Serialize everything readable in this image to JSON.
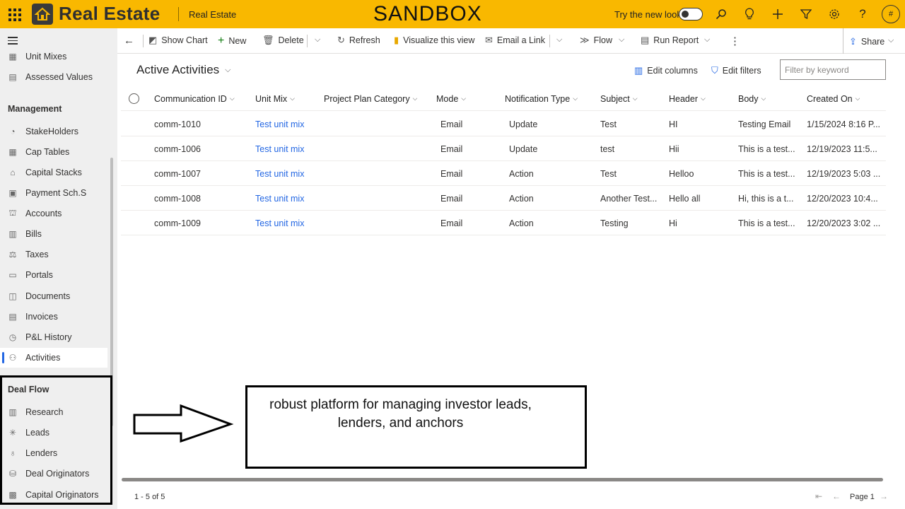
{
  "topbar": {
    "brand": "Real Estate",
    "app_name": "Real Estate",
    "environment": "SANDBOX",
    "try_new_look": "Try the new look",
    "avatar": "#",
    "accent_color": "#f9b800"
  },
  "sidebar": {
    "top_items": [
      {
        "label": "Unit Mixes",
        "icon": "table-icon"
      },
      {
        "label": "Assessed Values",
        "icon": "value-icon"
      }
    ],
    "management_heading": "Management",
    "management_items": [
      {
        "label": "StakeHolders",
        "icon": "stakeholder-icon"
      },
      {
        "label": "Cap Tables",
        "icon": "grid-icon"
      },
      {
        "label": "Capital Stacks",
        "icon": "stack-icon"
      },
      {
        "label": "Payment Sch.S",
        "icon": "calendar-icon"
      },
      {
        "label": "Accounts",
        "icon": "accounts-icon"
      },
      {
        "label": "Bills",
        "icon": "bill-icon"
      },
      {
        "label": "Taxes",
        "icon": "tax-icon"
      },
      {
        "label": "Portals",
        "icon": "portal-icon"
      },
      {
        "label": "Documents",
        "icon": "document-icon"
      },
      {
        "label": "Invoices",
        "icon": "invoice-icon"
      },
      {
        "label": "P&L History",
        "icon": "history-icon"
      },
      {
        "label": "Activities",
        "icon": "activities-icon"
      }
    ],
    "dealflow_heading": "Deal Flow",
    "dealflow_items": [
      {
        "label": "Research",
        "icon": "research-icon"
      },
      {
        "label": "Leads",
        "icon": "leads-icon"
      },
      {
        "label": "Lenders",
        "icon": "lenders-icon"
      },
      {
        "label": "Deal Originators",
        "icon": "originator-icon"
      },
      {
        "label": "Capital Originators",
        "icon": "capital-icon"
      }
    ]
  },
  "commandbar": {
    "show_chart": "Show Chart",
    "new": "New",
    "delete": "Delete",
    "refresh": "Refresh",
    "visualize": "Visualize this view",
    "email_link": "Email a Link",
    "flow": "Flow",
    "run_report": "Run Report",
    "share": "Share"
  },
  "view": {
    "title": "Active Activities",
    "edit_columns": "Edit columns",
    "edit_filters": "Edit filters",
    "filter_placeholder": "Filter by keyword"
  },
  "grid": {
    "columns": [
      "Communication ID",
      "Unit Mix",
      "Project Plan Category",
      "Mode",
      "Notification Type",
      "Subject",
      "Header",
      "Body",
      "Created On"
    ],
    "rows": [
      [
        "comm-1010",
        "Test unit mix",
        "",
        "Email",
        "Update",
        "Test",
        "HI",
        "Testing Email",
        "1/15/2024 8:16 P..."
      ],
      [
        "comm-1006",
        "Test unit mix",
        "",
        "Email",
        "Update",
        "test",
        "Hii",
        "This is a test...",
        "12/19/2023 11:5..."
      ],
      [
        "comm-1007",
        "Test unit mix",
        "",
        "Email",
        "Action",
        "Test",
        "Helloo",
        "This is a test...",
        "12/19/2023 5:03 ..."
      ],
      [
        "comm-1008",
        "Test unit mix",
        "",
        "Email",
        "Action",
        "Another Test...",
        "Hello all",
        "Hi, this is a t...",
        "12/20/2023 10:4..."
      ],
      [
        "comm-1009",
        "Test unit mix",
        "",
        "Email",
        "Action",
        "Testing",
        "Hi",
        "This is a test...",
        "12/20/2023 3:02 ..."
      ]
    ]
  },
  "footer": {
    "count": "1 - 5 of 5",
    "page": "Page 1"
  },
  "callout": {
    "line1": "robust platform for managing investor leads,",
    "line2": "lenders, and anchors"
  }
}
